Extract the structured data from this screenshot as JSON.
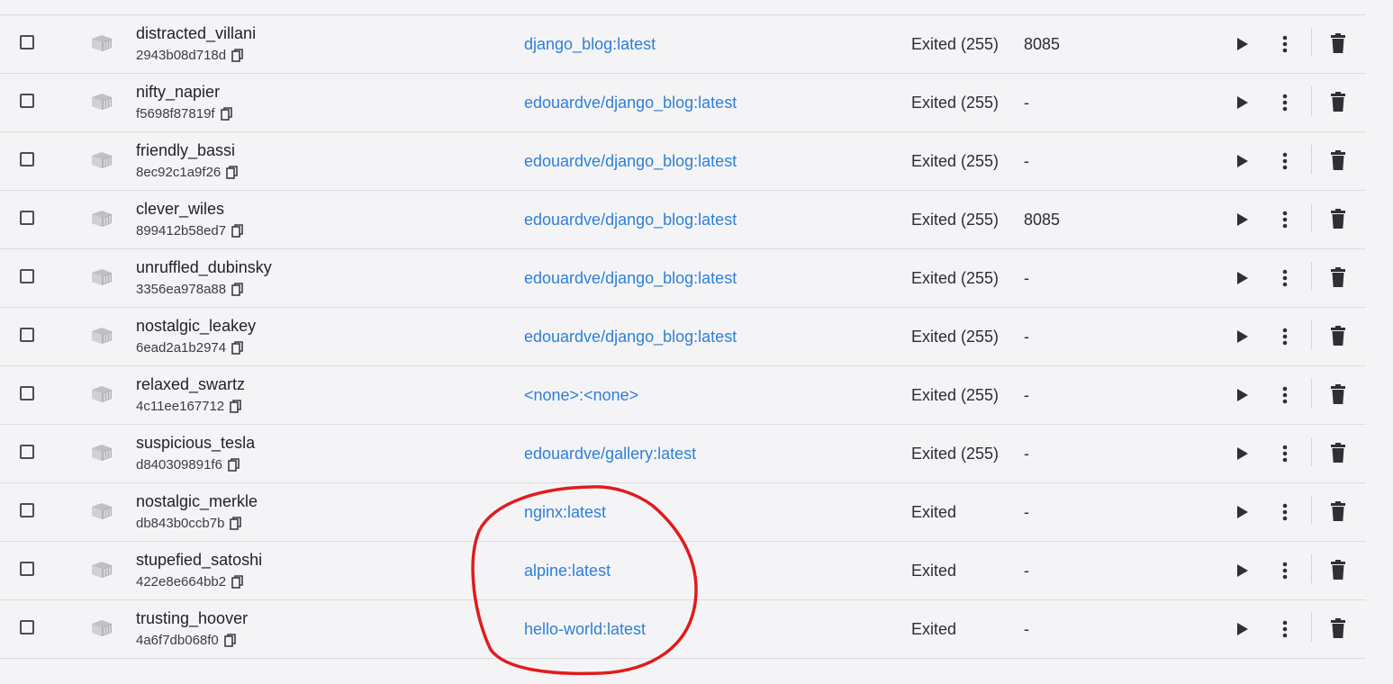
{
  "accent_colors": {
    "link": "#2e7fd9",
    "annotation": "#e01c1c"
  },
  "icons": {
    "row_select": "checkbox",
    "container": "container-icon",
    "copy": "copy-icon",
    "start": "play-icon",
    "more": "more-vertical-icon",
    "delete": "trash-icon"
  },
  "containers": [
    {
      "name": "distracted_villani",
      "id": "2943b08d718d",
      "image": "django_blog:latest",
      "status": "Exited (255)",
      "port": "8085"
    },
    {
      "name": "nifty_napier",
      "id": "f5698f87819f",
      "image": "edouardve/django_blog:latest",
      "status": "Exited (255)",
      "port": "-"
    },
    {
      "name": "friendly_bassi",
      "id": "8ec92c1a9f26",
      "image": "edouardve/django_blog:latest",
      "status": "Exited (255)",
      "port": "-"
    },
    {
      "name": "clever_wiles",
      "id": "899412b58ed7",
      "image": "edouardve/django_blog:latest",
      "status": "Exited (255)",
      "port": "8085"
    },
    {
      "name": "unruffled_dubinsky",
      "id": "3356ea978a88",
      "image": "edouardve/django_blog:latest",
      "status": "Exited (255)",
      "port": "-"
    },
    {
      "name": "nostalgic_leakey",
      "id": "6ead2a1b2974",
      "image": "edouardve/django_blog:latest",
      "status": "Exited (255)",
      "port": "-"
    },
    {
      "name": "relaxed_swartz",
      "id": "4c11ee167712",
      "image": "<none>:<none>",
      "status": "Exited (255)",
      "port": "-"
    },
    {
      "name": "suspicious_tesla",
      "id": "d840309891f6",
      "image": "edouardve/gallery:latest",
      "status": "Exited (255)",
      "port": "-"
    },
    {
      "name": "nostalgic_merkle",
      "id": "db843b0ccb7b",
      "image": "nginx:latest",
      "status": "Exited",
      "port": "-"
    },
    {
      "name": "stupefied_satoshi",
      "id": "422e8e664bb2",
      "image": "alpine:latest",
      "status": "Exited",
      "port": "-"
    },
    {
      "name": "trusting_hoover",
      "id": "4a6f7db068f0",
      "image": "hello-world:latest",
      "status": "Exited",
      "port": "-"
    }
  ]
}
